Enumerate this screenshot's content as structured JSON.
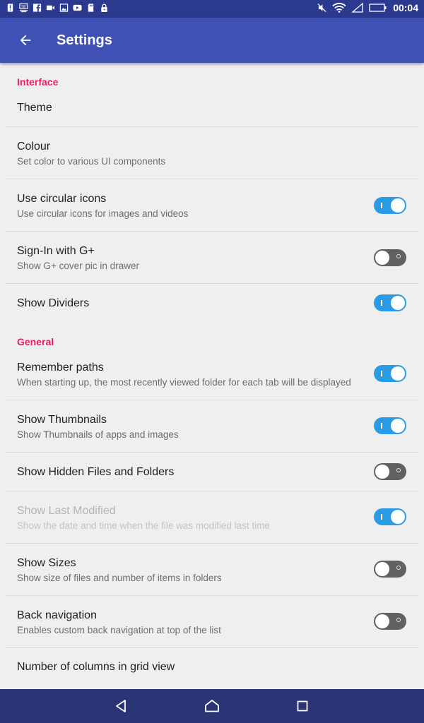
{
  "status_bar": {
    "time": "00:04",
    "left_icons": [
      "alert-icon",
      "usb-icon",
      "facebook-icon",
      "video-icon",
      "image-icon",
      "youtube-icon",
      "sd-card-icon",
      "lock-icon"
    ],
    "right_icons": [
      "mute-icon",
      "wifi-icon",
      "signal-icon",
      "battery-icon"
    ]
  },
  "app_bar": {
    "title": "Settings",
    "back_icon": "arrow-back-icon"
  },
  "sections": [
    {
      "header": "Interface"
    },
    {
      "header": "General"
    }
  ],
  "items": [
    {
      "title": "Theme"
    },
    {
      "title": "Colour",
      "summary": "Set color to various UI components"
    },
    {
      "title": "Use circular icons",
      "summary": "Use circular icons for images and videos",
      "switch": "on"
    },
    {
      "title": "Sign-In with G+",
      "summary": "Show G+ cover pic in drawer",
      "switch": "off"
    },
    {
      "title": "Show Dividers",
      "switch": "on"
    },
    {
      "title": "Remember paths",
      "summary": "When starting up, the most recently viewed folder for each tab will be displayed",
      "switch": "on"
    },
    {
      "title": "Show Thumbnails",
      "summary": "Show Thumbnails of apps and images",
      "switch": "on"
    },
    {
      "title": "Show Hidden Files and Folders",
      "switch": "off"
    },
    {
      "title": "Show Last Modified",
      "summary": "Show the date and time when the file was modified last time",
      "switch": "on",
      "disabled": true
    },
    {
      "title": "Show Sizes",
      "summary": "Show size of files and number of items in folders",
      "switch": "off"
    },
    {
      "title": "Back navigation",
      "summary": "Enables custom back navigation at top of the list",
      "switch": "off"
    },
    {
      "title": "Number of columns in grid view"
    }
  ],
  "colors": {
    "status_bar": "#2b3a8f",
    "app_bar": "#3f51b5",
    "section_header": "#e91e63",
    "switch_on": "#2c9be6",
    "switch_off": "#616161",
    "nav_bar": "#2b3476"
  },
  "nav_bar": {
    "icons": [
      "back-triangle-icon",
      "home-icon",
      "recents-square-icon"
    ]
  }
}
